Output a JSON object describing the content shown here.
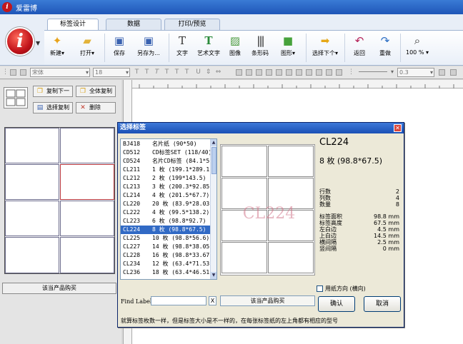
{
  "app": {
    "title": "爱雷博"
  },
  "tabs": [
    {
      "label": "标签设计",
      "active": true
    },
    {
      "label": "数据",
      "active": false
    },
    {
      "label": "打印/预览",
      "active": false
    }
  ],
  "toolbar": {
    "buttons": [
      {
        "label": "新建",
        "icon": "new-icon"
      },
      {
        "label": "打开",
        "icon": "open-folder-icon"
      },
      {
        "label": "保存",
        "icon": "save-icon"
      },
      {
        "label": "另存为...",
        "icon": "save-as-icon"
      },
      {
        "label": "文字",
        "icon": "text-icon"
      },
      {
        "label": "艺术文字",
        "icon": "art-text-icon"
      },
      {
        "label": "图像",
        "icon": "image-icon"
      },
      {
        "label": "条形码",
        "icon": "barcode-icon"
      },
      {
        "label": "图形",
        "icon": "shape-icon"
      },
      {
        "label": "选择下个",
        "icon": "select-next-icon"
      },
      {
        "label": "返回",
        "icon": "undo-icon"
      },
      {
        "label": "重做",
        "icon": "redo-icon"
      },
      {
        "label": "100 %",
        "icon": "zoom-icon"
      }
    ]
  },
  "format_bar": {
    "font": "宋体",
    "size": "18",
    "line_width": "0.3"
  },
  "left_panel": {
    "copy_next": "复制下一",
    "copy_all": "全体复制",
    "select_copy": "选择复制",
    "delete": "删除",
    "buy": "该当产品购买"
  },
  "dialog": {
    "title": "选择标签",
    "list": [
      {
        "code": "BJ418",
        "desc": "名片纸 (90*50)"
      },
      {
        "code": "CD512",
        "desc": "CD标签SET (118/40)"
      },
      {
        "code": "CD524",
        "desc": "名片CD标签 (84.1*5"
      },
      {
        "code": "CL211",
        "desc": "1 枚 (199.1*289.1)"
      },
      {
        "code": "CL212",
        "desc": "2 枚 (199*143.5)"
      },
      {
        "code": "CL213",
        "desc": "3 枚 (200.3*92.85)"
      },
      {
        "code": "CL214",
        "desc": "4 枚 (201.5*67.7)"
      },
      {
        "code": "CL220",
        "desc": "20 枚 (83.9*28.03)"
      },
      {
        "code": "CL222",
        "desc": "4 枚 (99.5*138.2)"
      },
      {
        "code": "CL223",
        "desc": "6 枚 (98.8*92.7)"
      },
      {
        "code": "CL224",
        "desc": "8 枚 (98.8*67.5)",
        "selected": true
      },
      {
        "code": "CL225",
        "desc": "10 枚 (98.8*56.6)"
      },
      {
        "code": "CL227",
        "desc": "14 枚 (98.8*38.05)"
      },
      {
        "code": "CL228",
        "desc": "16 枚 (98.8*33.67)"
      },
      {
        "code": "CL234",
        "desc": "12 枚 (63.4*71.53)"
      },
      {
        "code": "CL236",
        "desc": "18 枚 (63.4*46.51)"
      }
    ],
    "watermark": "CL224",
    "selected_code": "CL224",
    "selected_size": "8 枚 (98.8*67.5)",
    "info": [
      {
        "label": "行数",
        "value": "2"
      },
      {
        "label": "列数",
        "value": "4"
      },
      {
        "label": "数量",
        "value": "8"
      },
      {
        "label": "标签面积",
        "value": "98.8 mm"
      },
      {
        "label": "标签高度",
        "value": "67.5 mm"
      },
      {
        "label": "左白边",
        "value": "4.5 mm"
      },
      {
        "label": "上白边",
        "value": "14.5 mm"
      },
      {
        "label": "横间隔",
        "value": "2.5 mm"
      },
      {
        "label": "竖间隔",
        "value": "0 mm"
      }
    ],
    "orientation_label": "用纸方向 (横向)",
    "find_label": "Find Label",
    "find_value": "",
    "clear_label": "X",
    "buy_label": "该当产品购买",
    "ok_label": "确认",
    "cancel_label": "取消",
    "hint": "就算标签枚数一样，但是标签大小是不一样的，在每张标签纸的左上角都有相应的型号"
  }
}
